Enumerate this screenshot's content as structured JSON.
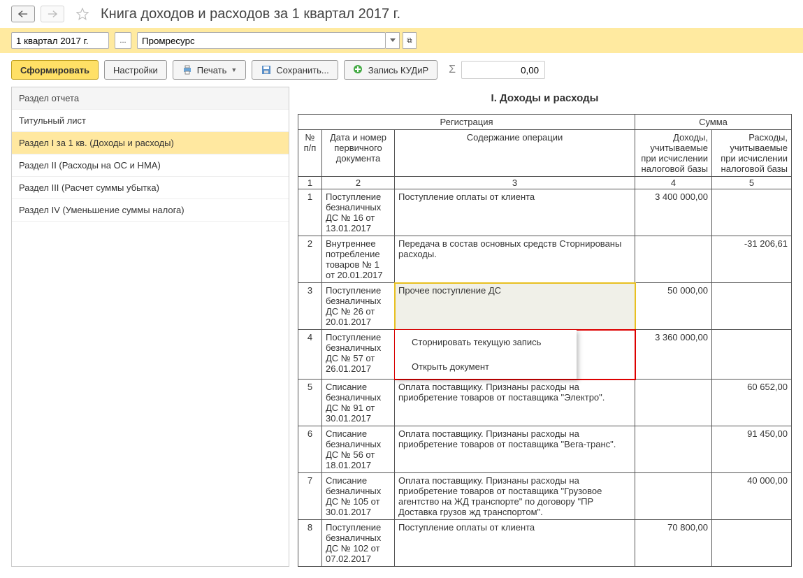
{
  "title": "Книга доходов и расходов за 1 квартал 2017 г.",
  "period": "1 квартал 2017 г.",
  "org": "Промресурс",
  "sum_field": "0,00",
  "buttons": {
    "form": "Сформировать",
    "settings": "Настройки",
    "print": "Печать",
    "save": "Сохранить...",
    "kudir": "Запись КУДиР"
  },
  "sidebar": {
    "header": "Раздел отчета",
    "items": [
      "Титульный лист",
      "Раздел I за 1 кв. (Доходы и расходы)",
      "Раздел II (Расходы на ОС и НМА)",
      "Раздел III (Расчет суммы убытка)",
      "Раздел IV (Уменьшение суммы налога)"
    ]
  },
  "section_title": "I. Доходы и расходы",
  "headers": {
    "reg": "Регистрация",
    "sum": "Сумма",
    "n": "№ п/п",
    "doc": "Дата и номер первичного документа",
    "op": "Содержание операции",
    "in": "Доходы, учитываемые при исчислении налоговой базы",
    "out": "Расходы, учитываемые при исчислении налоговой базы"
  },
  "colnums": [
    "1",
    "2",
    "3",
    "4",
    "5"
  ],
  "context": {
    "storno": "Сторнировать текущую запись",
    "open": "Открыть документ"
  },
  "rows": [
    {
      "n": "1",
      "doc": "Поступление безналичных ДС № 16 от 13.01.2017",
      "op": "Поступление оплаты от клиента",
      "in": "3 400 000,00",
      "out": ""
    },
    {
      "n": "2",
      "doc": "Внутреннее потребление товаров № 1 от 20.01.2017",
      "op": "Передача в состав основных средств Сторнированы расходы.",
      "in": "",
      "out": "-31 206,61"
    },
    {
      "n": "3",
      "doc": "Поступление безналичных ДС № 26 от 20.01.2017",
      "op": "Прочее поступление ДС",
      "in": "50 000,00",
      "out": ""
    },
    {
      "n": "4",
      "doc": "Поступление безналичных ДС № 57 от 26.01.2017",
      "op": "",
      "in": "3 360 000,00",
      "out": ""
    },
    {
      "n": "5",
      "doc": "Списание безналичных ДС № 91 от 30.01.2017",
      "op": "Оплата поставщику. Признаны расходы на приобретение товаров от поставщика \"Электро\".",
      "in": "",
      "out": "60 652,00"
    },
    {
      "n": "6",
      "doc": "Списание безналичных ДС № 56 от 18.01.2017",
      "op": "Оплата поставщику. Признаны расходы на приобретение товаров от поставщика \"Вега-транс\".",
      "in": "",
      "out": "91 450,00"
    },
    {
      "n": "7",
      "doc": "Списание безналичных ДС № 105 от 30.01.2017",
      "op": "Оплата поставщику. Признаны расходы на приобретение товаров от поставщика \"Грузовое агентство на ЖД транспорте\" по договору \"ПР Доставка грузов жд транспортом\".",
      "in": "",
      "out": "40 000,00"
    },
    {
      "n": "8",
      "doc": "Поступление безналичных ДС № 102 от 07.02.2017",
      "op": "Поступление оплаты от клиента",
      "in": "70 800,00",
      "out": ""
    }
  ]
}
